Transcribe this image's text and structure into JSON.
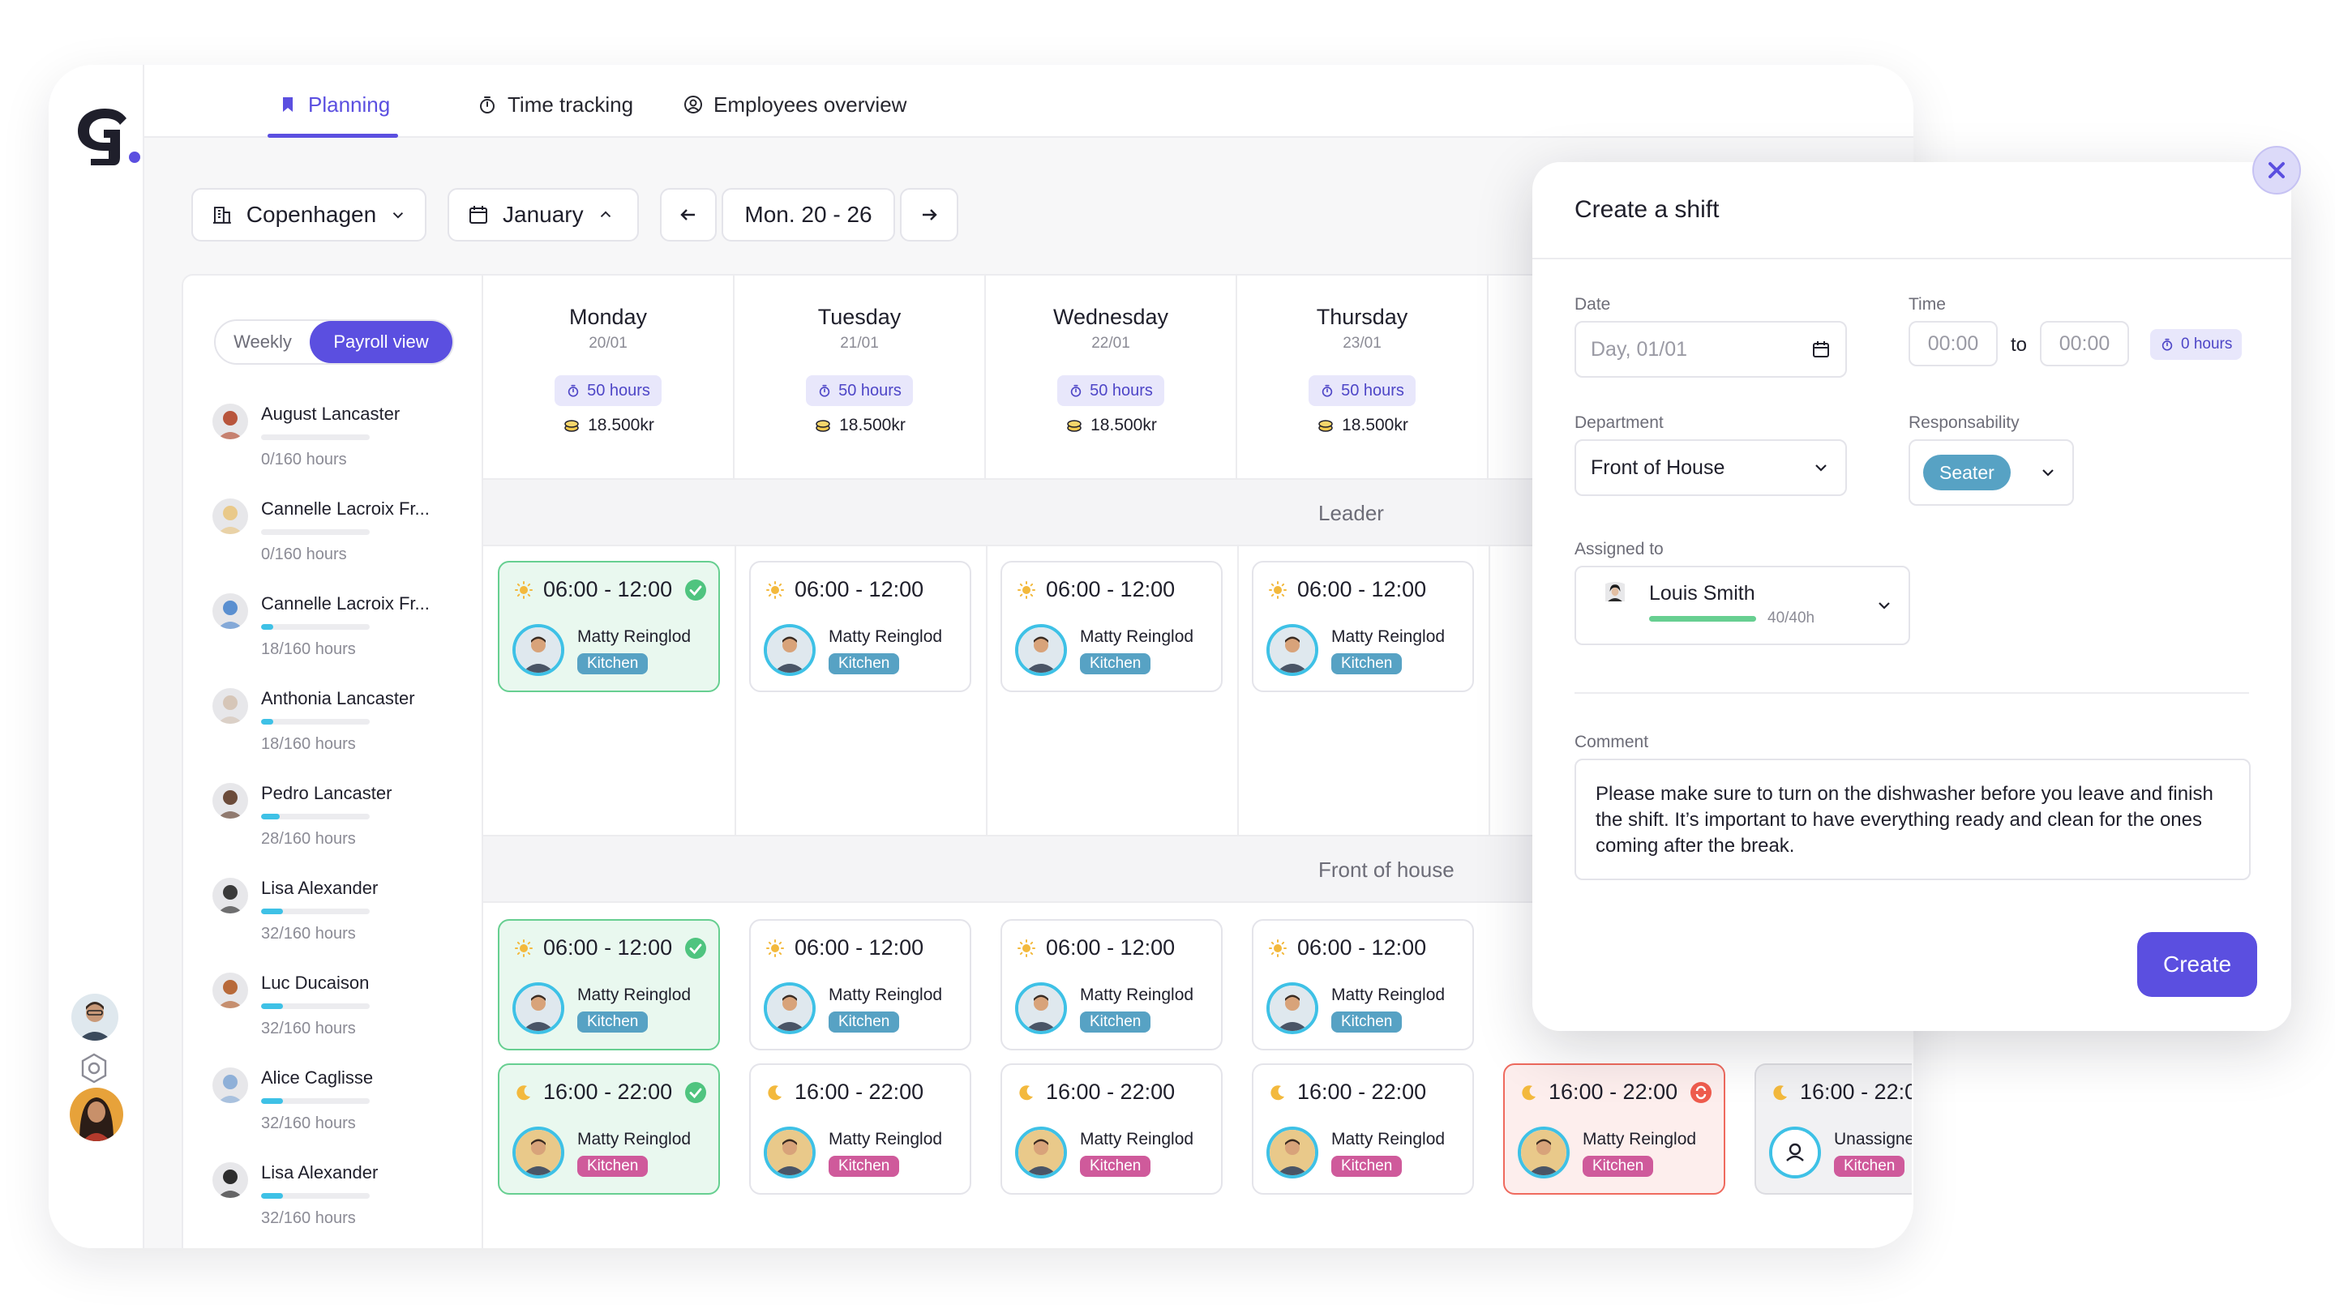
{
  "nav": {
    "tabs": [
      {
        "label": "Planning",
        "icon": "bookmark-icon"
      },
      {
        "label": "Time tracking",
        "icon": "stopwatch-icon"
      },
      {
        "label": "Employees overview",
        "icon": "user-circle-icon"
      }
    ]
  },
  "toolbar": {
    "location": "Copenhagen",
    "month": "January",
    "week_range": "Mon. 20 - 26"
  },
  "view_toggle": {
    "weekly": "Weekly",
    "payroll": "Payroll view",
    "active": "Payroll view"
  },
  "employees": [
    {
      "name": "August Lancaster",
      "hours": "0/160 hours",
      "progress": 0
    },
    {
      "name": "Cannelle Lacroix Fr...",
      "hours": "0/160 hours",
      "progress": 0
    },
    {
      "name": "Cannelle Lacroix Fr...",
      "hours": "18/160 hours",
      "progress": 0.11
    },
    {
      "name": "Anthonia Lancaster",
      "hours": "18/160 hours",
      "progress": 0.11
    },
    {
      "name": "Pedro Lancaster",
      "hours": "28/160 hours",
      "progress": 0.175
    },
    {
      "name": "Lisa Alexander",
      "hours": "32/160 hours",
      "progress": 0.2
    },
    {
      "name": "Luc Ducaison",
      "hours": "32/160 hours",
      "progress": 0.2
    },
    {
      "name": "Alice Caglisse",
      "hours": "32/160 hours",
      "progress": 0.2
    },
    {
      "name": "Lisa Alexander",
      "hours": "32/160 hours",
      "progress": 0.2
    }
  ],
  "days": [
    {
      "name": "Monday",
      "date": "20/01",
      "hours": "50 hours",
      "cost": "18.500kr"
    },
    {
      "name": "Tuesday",
      "date": "21/01",
      "hours": "50 hours",
      "cost": "18.500kr"
    },
    {
      "name": "Wednesday",
      "date": "22/01",
      "hours": "50 hours",
      "cost": "18.500kr"
    },
    {
      "name": "Thursday",
      "date": "23/01",
      "hours": "50 hours",
      "cost": "18.500kr"
    }
  ],
  "sections": {
    "leader": "Leader",
    "front": "Front of house"
  },
  "shift_labels": {
    "morning": "06:00 - 12:00",
    "evening": "16:00 - 22:00",
    "evening_cut": "16:00 - 22:0",
    "person": "Matty Reinglod",
    "unassigned": "Unassigne",
    "dept": "Kitchen"
  },
  "modal": {
    "title": "Create a shift",
    "date_label": "Date",
    "date_placeholder": "Day, 01/01",
    "time_label": "Time",
    "time_from": "00:00",
    "time_sep": "to",
    "time_to": "00:00",
    "time_hours": "0 hours",
    "department_label": "Department",
    "department_value": "Front of House",
    "responsibility_label": "Responsability",
    "responsibility_value": "Seater",
    "assigned_label": "Assigned to",
    "assigned_name": "Louis Smith",
    "assigned_hours": "40/40h",
    "assigned_progress": 1,
    "comment_label": "Comment",
    "comment_text": "Please make sure to turn on the dishwasher before you leave and finish the shift. It’s important to have everything ready and clean for the ones coming after the break.",
    "create_label": "Create"
  },
  "colors": {
    "accent": "#5b4fe0",
    "green": "#67cf91",
    "red": "#ef6a5e",
    "cyan": "#3ec1e6",
    "kitchen_blue": "#57a2c4",
    "kitchen_pink": "#cf5a9b"
  }
}
